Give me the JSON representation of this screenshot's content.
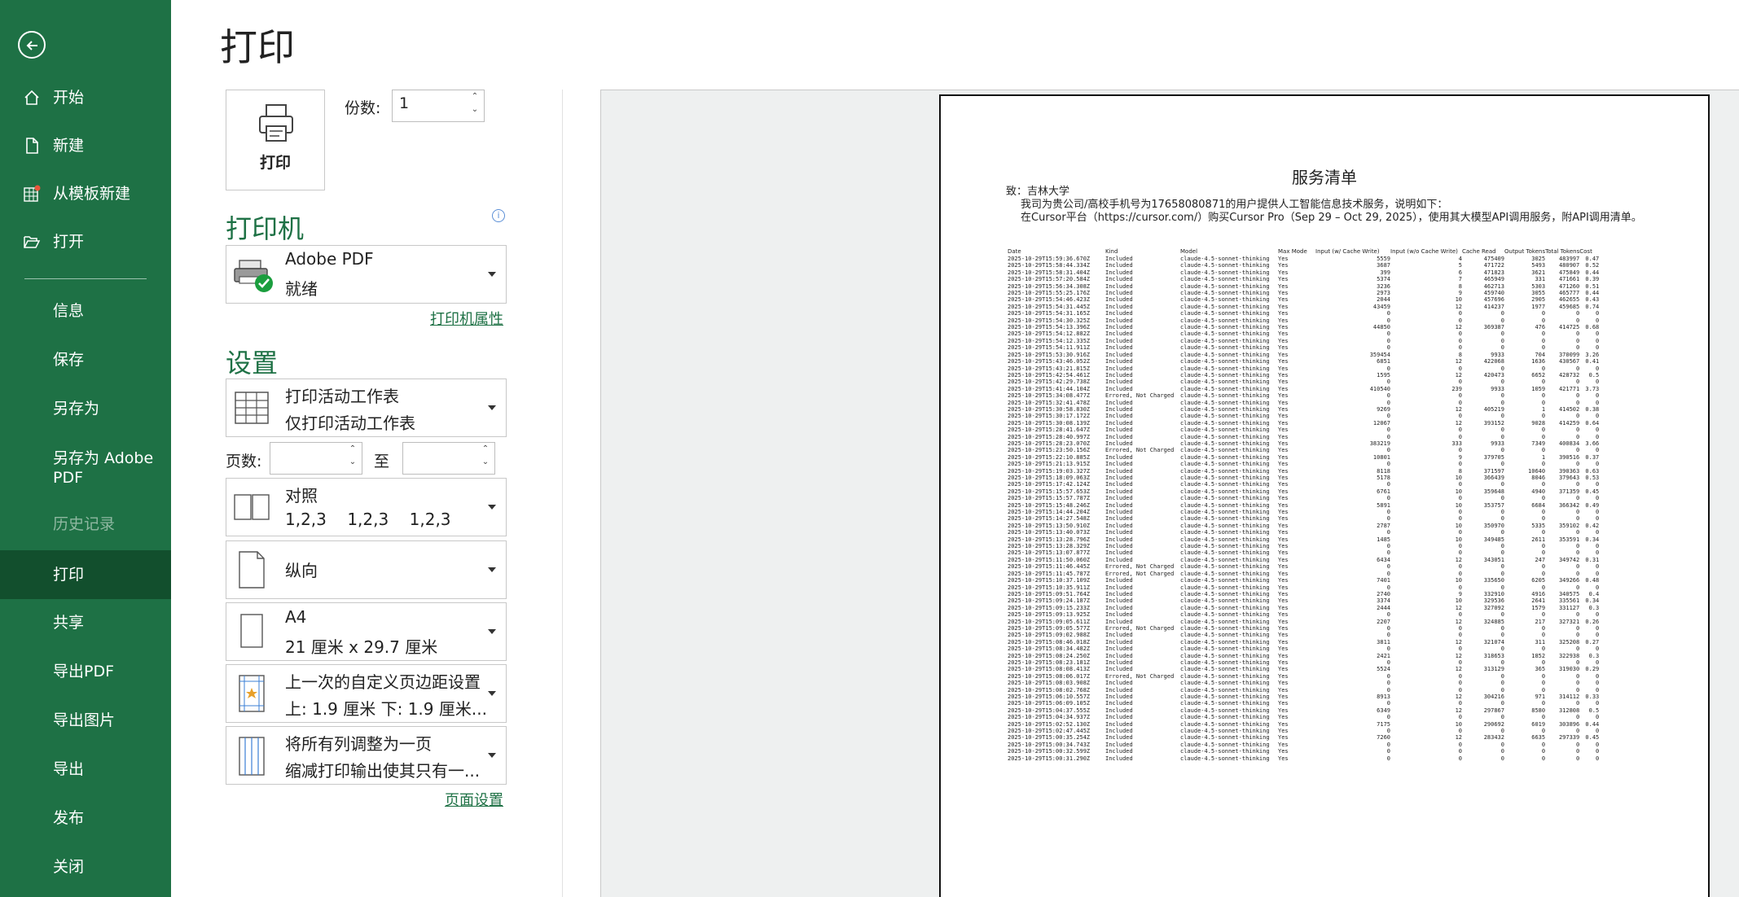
{
  "sidebar": {
    "back_icon": "arrow-left-circle-icon",
    "items": [
      {
        "label": "开始",
        "icon": "home-icon"
      },
      {
        "label": "新建",
        "icon": "new-file-icon"
      },
      {
        "label": "从模板新建",
        "icon": "template-icon"
      },
      {
        "label": "打开",
        "icon": "folder-open-icon"
      },
      {
        "label": "信息"
      },
      {
        "label": "保存"
      },
      {
        "label": "另存为"
      },
      {
        "label": "另存为 Adobe PDF"
      },
      {
        "label": "历史记录"
      },
      {
        "label": "打印"
      },
      {
        "label": "共享"
      },
      {
        "label": "导出PDF"
      },
      {
        "label": "导出图片"
      },
      {
        "label": "导出"
      },
      {
        "label": "发布"
      },
      {
        "label": "关闭"
      }
    ],
    "active": "打印",
    "disabled": "历史记录"
  },
  "main": {
    "title": "打印",
    "print_button_label": "打印",
    "copies_label": "份数:",
    "copies_value": "1",
    "printer_header": "打印机",
    "printer": {
      "name": "Adobe PDF",
      "status": "就绪"
    },
    "printer_properties_link": "打印机属性",
    "settings_header": "设置",
    "print_what": {
      "line1": "打印活动工作表",
      "line2": "仅打印活动工作表"
    },
    "pages_label": "页数:",
    "pages_to_label": "至",
    "pages_from": "",
    "pages_to": "",
    "collation": {
      "line1": "对照",
      "line2": "1,2,3    1,2,3    1,2,3"
    },
    "orientation": {
      "line1": "纵向"
    },
    "paper_size": {
      "line1": "A4",
      "line2": "21 厘米 x 29.7 厘米"
    },
    "margins": {
      "line1": "上一次的自定义页边距设置",
      "line2": "上: 1.9 厘米 下: 1.9 厘米..."
    },
    "scaling": {
      "line1": "将所有列调整为一页",
      "line2": "缩减打印输出使其只有一..."
    },
    "page_setup_link": "页面设置"
  },
  "colors": {
    "sidebar_bg": "#1e7145",
    "sidebar_active": "#124f2d",
    "accent": "#1e7145"
  },
  "preview": {
    "doc_title": "服务清单",
    "to_line": "致：吉林大学",
    "intro_line1": "我司为贵公司/高校手机号为17658080871的用户提供人工智能信息技术服务，说明如下：",
    "intro_line2": "在Cursor平台（https://cursor.com/）购买Cursor Pro（Sep 29 – Oct 29, 2025），使用其大模型API调用服务，附API调用清单。",
    "columns": [
      "Date",
      "Kind",
      "Model",
      "Max Mode",
      "Input (w/ Cache Write)",
      "Input (w/o Cache Write)",
      "Cache Read",
      "Output Tokens",
      "Total Tokens",
      "Cost"
    ],
    "rows": [
      [
        "2025-10-29T15:59:36.670Z",
        "Included",
        "claude-4.5-sonnet-thinking",
        "Yes",
        "5559",
        "4",
        "475409",
        "3025",
        "483997",
        "0.47"
      ],
      [
        "2025-10-29T15:58:44.334Z",
        "Included",
        "claude-4.5-sonnet-thinking",
        "Yes",
        "3687",
        "5",
        "471722",
        "5493",
        "480907",
        "0.52"
      ],
      [
        "2025-10-29T15:58:31.404Z",
        "Included",
        "claude-4.5-sonnet-thinking",
        "Yes",
        "399",
        "6",
        "471823",
        "3621",
        "475849",
        "0.44"
      ],
      [
        "2025-10-29T15:57:20.584Z",
        "Included",
        "claude-4.5-sonnet-thinking",
        "Yes",
        "5374",
        "7",
        "465949",
        "331",
        "471661",
        "0.39"
      ],
      [
        "2025-10-29T15:56:34.308Z",
        "Included",
        "claude-4.5-sonnet-thinking",
        "Yes",
        "3236",
        "8",
        "462713",
        "5303",
        "471260",
        "0.51"
      ],
      [
        "2025-10-29T15:55:25.176Z",
        "Included",
        "claude-4.5-sonnet-thinking",
        "Yes",
        "2973",
        "9",
        "459740",
        "3055",
        "465777",
        "0.44"
      ],
      [
        "2025-10-29T15:54:46.423Z",
        "Included",
        "claude-4.5-sonnet-thinking",
        "Yes",
        "2044",
        "10",
        "457696",
        "2905",
        "462655",
        "0.43"
      ],
      [
        "2025-10-29T15:54:31.445Z",
        "Included",
        "claude-4.5-sonnet-thinking",
        "Yes",
        "43459",
        "12",
        "414237",
        "1977",
        "459685",
        "0.74"
      ],
      [
        "2025-10-29T15:54:31.165Z",
        "Included",
        "claude-4.5-sonnet-thinking",
        "Yes",
        "0",
        "0",
        "0",
        "0",
        "0",
        "0"
      ],
      [
        "2025-10-29T15:54:30.325Z",
        "Included",
        "claude-4.5-sonnet-thinking",
        "Yes",
        "0",
        "0",
        "0",
        "0",
        "0",
        "0"
      ],
      [
        "2025-10-29T15:54:13.396Z",
        "Included",
        "claude-4.5-sonnet-thinking",
        "Yes",
        "44850",
        "12",
        "369387",
        "476",
        "414725",
        "0.68"
      ],
      [
        "2025-10-29T15:54:12.882Z",
        "Included",
        "claude-4.5-sonnet-thinking",
        "Yes",
        "0",
        "0",
        "0",
        "0",
        "0",
        "0"
      ],
      [
        "2025-10-29T15:54:12.335Z",
        "Included",
        "claude-4.5-sonnet-thinking",
        "Yes",
        "0",
        "0",
        "0",
        "0",
        "0",
        "0"
      ],
      [
        "2025-10-29T15:54:11.911Z",
        "Included",
        "claude-4.5-sonnet-thinking",
        "Yes",
        "0",
        "0",
        "0",
        "0",
        "0",
        "0"
      ],
      [
        "2025-10-29T15:53:30.916Z",
        "Included",
        "claude-4.5-sonnet-thinking",
        "Yes",
        "359454",
        "8",
        "9933",
        "704",
        "370099",
        "3.26"
      ],
      [
        "2025-10-29T15:43:46.052Z",
        "Included",
        "claude-4.5-sonnet-thinking",
        "Yes",
        "6851",
        "12",
        "422068",
        "1636",
        "430567",
        "0.41"
      ],
      [
        "2025-10-29T15:43:21.815Z",
        "Included",
        "claude-4.5-sonnet-thinking",
        "Yes",
        "0",
        "0",
        "0",
        "0",
        "0",
        "0"
      ],
      [
        "2025-10-29T15:42:54.461Z",
        "Included",
        "claude-4.5-sonnet-thinking",
        "Yes",
        "1595",
        "12",
        "420473",
        "6652",
        "428732",
        "0.5"
      ],
      [
        "2025-10-29T15:42:29.738Z",
        "Included",
        "claude-4.5-sonnet-thinking",
        "Yes",
        "0",
        "0",
        "0",
        "0",
        "0",
        "0"
      ],
      [
        "2025-10-29T15:41:44.104Z",
        "Included",
        "claude-4.5-sonnet-thinking",
        "Yes",
        "410540",
        "239",
        "9933",
        "1059",
        "421771",
        "3.73"
      ],
      [
        "2025-10-29T15:34:08.477Z",
        "Errored, Not Charged",
        "claude-4.5-sonnet-thinking",
        "Yes",
        "0",
        "0",
        "0",
        "0",
        "0",
        "0"
      ],
      [
        "2025-10-29T15:32:41.478Z",
        "Included",
        "claude-4.5-sonnet-thinking",
        "Yes",
        "0",
        "0",
        "0",
        "0",
        "0",
        "0"
      ],
      [
        "2025-10-29T15:30:58.830Z",
        "Included",
        "claude-4.5-sonnet-thinking",
        "Yes",
        "9269",
        "12",
        "405219",
        "1",
        "414502",
        "0.38"
      ],
      [
        "2025-10-29T15:30:17.172Z",
        "Included",
        "claude-4.5-sonnet-thinking",
        "Yes",
        "0",
        "0",
        "0",
        "0",
        "0",
        "0"
      ],
      [
        "2025-10-29T15:30:08.139Z",
        "Included",
        "claude-4.5-sonnet-thinking",
        "Yes",
        "12067",
        "12",
        "393152",
        "9028",
        "414259",
        "0.64"
      ],
      [
        "2025-10-29T15:28:41.647Z",
        "Included",
        "claude-4.5-sonnet-thinking",
        "Yes",
        "0",
        "0",
        "0",
        "0",
        "0",
        "0"
      ],
      [
        "2025-10-29T15:28:40.997Z",
        "Included",
        "claude-4.5-sonnet-thinking",
        "Yes",
        "0",
        "0",
        "0",
        "0",
        "0",
        "0"
      ],
      [
        "2025-10-29T15:28:23.070Z",
        "Included",
        "claude-4.5-sonnet-thinking",
        "Yes",
        "383219",
        "333",
        "9933",
        "7349",
        "400834",
        "3.66"
      ],
      [
        "2025-10-29T15:23:50.156Z",
        "Errored, Not Charged",
        "claude-4.5-sonnet-thinking",
        "Yes",
        "0",
        "0",
        "0",
        "0",
        "0",
        "0"
      ],
      [
        "2025-10-29T15:22:10.885Z",
        "Included",
        "claude-4.5-sonnet-thinking",
        "Yes",
        "10801",
        "9",
        "379705",
        "1",
        "390516",
        "0.37"
      ],
      [
        "2025-10-29T15:21:13.915Z",
        "Included",
        "claude-4.5-sonnet-thinking",
        "Yes",
        "0",
        "0",
        "0",
        "0",
        "0",
        "0"
      ],
      [
        "2025-10-29T15:19:03.327Z",
        "Included",
        "claude-4.5-sonnet-thinking",
        "Yes",
        "8118",
        "8",
        "371597",
        "10640",
        "390363",
        "0.63"
      ],
      [
        "2025-10-29T15:18:09.063Z",
        "Included",
        "claude-4.5-sonnet-thinking",
        "Yes",
        "5178",
        "10",
        "366439",
        "8046",
        "379643",
        "0.53"
      ],
      [
        "2025-10-29T15:17:42.124Z",
        "Included",
        "claude-4.5-sonnet-thinking",
        "Yes",
        "0",
        "0",
        "0",
        "0",
        "0",
        "0"
      ],
      [
        "2025-10-29T15:15:57.653Z",
        "Included",
        "claude-4.5-sonnet-thinking",
        "Yes",
        "6761",
        "10",
        "359648",
        "4940",
        "371359",
        "0.45"
      ],
      [
        "2025-10-29T15:15:57.787Z",
        "Included",
        "claude-4.5-sonnet-thinking",
        "Yes",
        "0",
        "0",
        "0",
        "0",
        "0",
        "0"
      ],
      [
        "2025-10-29T15:15:48.246Z",
        "Included",
        "claude-4.5-sonnet-thinking",
        "Yes",
        "5891",
        "10",
        "353757",
        "6684",
        "366342",
        "0.49"
      ],
      [
        "2025-10-29T15:14:44.204Z",
        "Included",
        "claude-4.5-sonnet-thinking",
        "Yes",
        "0",
        "0",
        "0",
        "0",
        "0",
        "0"
      ],
      [
        "2025-10-29T15:14:27.548Z",
        "Included",
        "claude-4.5-sonnet-thinking",
        "Yes",
        "0",
        "0",
        "0",
        "0",
        "0",
        "0"
      ],
      [
        "2025-10-29T15:13:50.910Z",
        "Included",
        "claude-4.5-sonnet-thinking",
        "Yes",
        "2787",
        "10",
        "350970",
        "5335",
        "359102",
        "0.42"
      ],
      [
        "2025-10-29T15:13:40.073Z",
        "Included",
        "claude-4.5-sonnet-thinking",
        "Yes",
        "0",
        "0",
        "0",
        "0",
        "0",
        "0"
      ],
      [
        "2025-10-29T15:13:28.796Z",
        "Included",
        "claude-4.5-sonnet-thinking",
        "Yes",
        "1485",
        "10",
        "349485",
        "2611",
        "353591",
        "0.34"
      ],
      [
        "2025-10-29T15:13:28.329Z",
        "Included",
        "claude-4.5-sonnet-thinking",
        "Yes",
        "0",
        "0",
        "0",
        "0",
        "0",
        "0"
      ],
      [
        "2025-10-29T15:13:07.877Z",
        "Included",
        "claude-4.5-sonnet-thinking",
        "Yes",
        "0",
        "0",
        "0",
        "0",
        "0",
        "0"
      ],
      [
        "2025-10-29T15:11:50.060Z",
        "Included",
        "claude-4.5-sonnet-thinking",
        "Yes",
        "6434",
        "12",
        "343051",
        "247",
        "349742",
        "0.31"
      ],
      [
        "2025-10-29T15:11:46.445Z",
        "Errored, Not Charged",
        "claude-4.5-sonnet-thinking",
        "Yes",
        "0",
        "0",
        "0",
        "0",
        "0",
        "0"
      ],
      [
        "2025-10-29T15:11:45.787Z",
        "Errored, Not Charged",
        "claude-4.5-sonnet-thinking",
        "Yes",
        "0",
        "0",
        "0",
        "0",
        "0",
        "0"
      ],
      [
        "2025-10-29T15:10:37.109Z",
        "Included",
        "claude-4.5-sonnet-thinking",
        "Yes",
        "7401",
        "10",
        "335650",
        "6205",
        "349266",
        "0.48"
      ],
      [
        "2025-10-29T15:10:35.911Z",
        "Included",
        "claude-4.5-sonnet-thinking",
        "Yes",
        "0",
        "0",
        "0",
        "0",
        "0",
        "0"
      ],
      [
        "2025-10-29T15:09:51.764Z",
        "Included",
        "claude-4.5-sonnet-thinking",
        "Yes",
        "2740",
        "9",
        "332910",
        "4916",
        "340575",
        "0.4"
      ],
      [
        "2025-10-29T15:09:24.187Z",
        "Included",
        "claude-4.5-sonnet-thinking",
        "Yes",
        "3374",
        "10",
        "329536",
        "2641",
        "335561",
        "0.34"
      ],
      [
        "2025-10-29T15:09:15.233Z",
        "Included",
        "claude-4.5-sonnet-thinking",
        "Yes",
        "2444",
        "12",
        "327092",
        "1579",
        "331127",
        "0.3"
      ],
      [
        "2025-10-29T15:09:13.925Z",
        "Included",
        "claude-4.5-sonnet-thinking",
        "Yes",
        "0",
        "0",
        "0",
        "0",
        "0",
        "0"
      ],
      [
        "2025-10-29T15:09:05.611Z",
        "Included",
        "claude-4.5-sonnet-thinking",
        "Yes",
        "2207",
        "12",
        "324885",
        "217",
        "327321",
        "0.26"
      ],
      [
        "2025-10-29T15:09:05.577Z",
        "Errored, Not Charged",
        "claude-4.5-sonnet-thinking",
        "Yes",
        "0",
        "0",
        "0",
        "0",
        "0",
        "0"
      ],
      [
        "2025-10-29T15:09:02.988Z",
        "Included",
        "claude-4.5-sonnet-thinking",
        "Yes",
        "0",
        "0",
        "0",
        "0",
        "0",
        "0"
      ],
      [
        "2025-10-29T15:08:46.018Z",
        "Included",
        "claude-4.5-sonnet-thinking",
        "Yes",
        "3811",
        "12",
        "321074",
        "311",
        "325208",
        "0.27"
      ],
      [
        "2025-10-29T15:08:34.482Z",
        "Included",
        "claude-4.5-sonnet-thinking",
        "Yes",
        "0",
        "0",
        "0",
        "0",
        "0",
        "0"
      ],
      [
        "2025-10-29T15:08:24.250Z",
        "Included",
        "claude-4.5-sonnet-thinking",
        "Yes",
        "2421",
        "12",
        "318653",
        "1852",
        "322938",
        "0.3"
      ],
      [
        "2025-10-29T15:08:23.181Z",
        "Included",
        "claude-4.5-sonnet-thinking",
        "Yes",
        "0",
        "0",
        "0",
        "0",
        "0",
        "0"
      ],
      [
        "2025-10-29T15:08:08.413Z",
        "Included",
        "claude-4.5-sonnet-thinking",
        "Yes",
        "5524",
        "12",
        "313129",
        "365",
        "319030",
        "0.29"
      ],
      [
        "2025-10-29T15:08:06.017Z",
        "Errored, Not Charged",
        "claude-4.5-sonnet-thinking",
        "Yes",
        "0",
        "0",
        "0",
        "0",
        "0",
        "0"
      ],
      [
        "2025-10-29T15:08:03.908Z",
        "Included",
        "claude-4.5-sonnet-thinking",
        "Yes",
        "0",
        "0",
        "0",
        "0",
        "0",
        "0"
      ],
      [
        "2025-10-29T15:08:02.768Z",
        "Included",
        "claude-4.5-sonnet-thinking",
        "Yes",
        "0",
        "0",
        "0",
        "0",
        "0",
        "0"
      ],
      [
        "2025-10-29T15:06:10.557Z",
        "Included",
        "claude-4.5-sonnet-thinking",
        "Yes",
        "8913",
        "12",
        "304216",
        "971",
        "314112",
        "0.33"
      ],
      [
        "2025-10-29T15:06:09.105Z",
        "Included",
        "claude-4.5-sonnet-thinking",
        "Yes",
        "0",
        "0",
        "0",
        "0",
        "0",
        "0"
      ],
      [
        "2025-10-29T15:04:37.555Z",
        "Included",
        "claude-4.5-sonnet-thinking",
        "Yes",
        "6349",
        "12",
        "297867",
        "8580",
        "312808",
        "0.5"
      ],
      [
        "2025-10-29T15:04:34.937Z",
        "Included",
        "claude-4.5-sonnet-thinking",
        "Yes",
        "0",
        "0",
        "0",
        "0",
        "0",
        "0"
      ],
      [
        "2025-10-29T15:02:52.130Z",
        "Included",
        "claude-4.5-sonnet-thinking",
        "Yes",
        "7175",
        "10",
        "290692",
        "6019",
        "303896",
        "0.44"
      ],
      [
        "2025-10-29T15:02:47.445Z",
        "Included",
        "claude-4.5-sonnet-thinking",
        "Yes",
        "0",
        "0",
        "0",
        "0",
        "0",
        "0"
      ],
      [
        "2025-10-29T15:00:35.254Z",
        "Included",
        "claude-4.5-sonnet-thinking",
        "Yes",
        "7260",
        "12",
        "283432",
        "6635",
        "297339",
        "0.45"
      ],
      [
        "2025-10-29T15:00:34.743Z",
        "Included",
        "claude-4.5-sonnet-thinking",
        "Yes",
        "0",
        "0",
        "0",
        "0",
        "0",
        "0"
      ],
      [
        "2025-10-29T15:00:32.599Z",
        "Included",
        "claude-4.5-sonnet-thinking",
        "Yes",
        "0",
        "0",
        "0",
        "0",
        "0",
        "0"
      ],
      [
        "2025-10-29T15:00:31.290Z",
        "Included",
        "claude-4.5-sonnet-thinking",
        "Yes",
        "0",
        "0",
        "0",
        "0",
        "0",
        "0"
      ]
    ]
  }
}
